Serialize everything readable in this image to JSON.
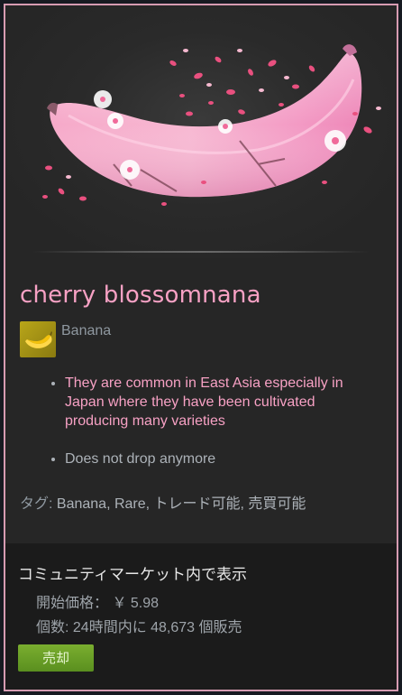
{
  "item": {
    "name": "cherry blossomnana",
    "game": "Banana",
    "descriptions": [
      "They are common in East Asia especially in Japan where they have been cultivated producing many varieties",
      "Does not drop anymore"
    ],
    "tags_label": "タグ: ",
    "tags_values": "Banana, Rare, トレード可能, 売買可能"
  },
  "market": {
    "title": "コミュニティマーケット内で表示",
    "start_price": "開始価格： ￥ 5.98",
    "volume": "個数: 24時間内に 48,673 個販売",
    "sell_label": "売却"
  },
  "colors": {
    "border": "#d79cb2",
    "name": "#f7a1c4",
    "sell_button": "#6ea027"
  }
}
